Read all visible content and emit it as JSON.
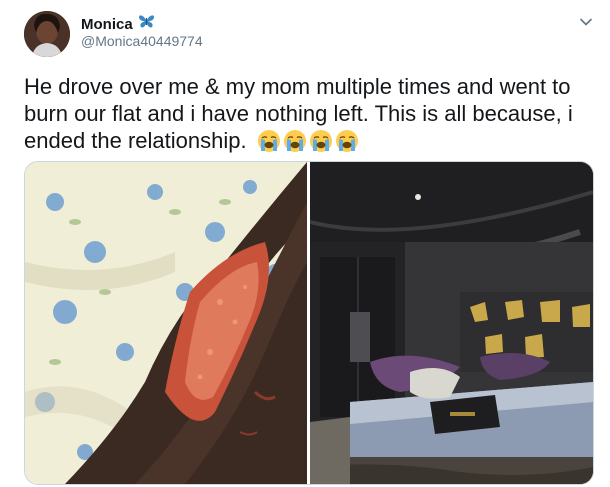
{
  "tweet": {
    "author": {
      "display_name": "Monica",
      "handle": "@Monica40449774",
      "name_badge_icon": "butterfly-icon"
    },
    "text": "He drove over me & my mom multiple times and went to burn our flat and i have nothing left. This is all because, i ended the relationship.",
    "emoji_icons": [
      "crying-face-icon",
      "crying-face-icon",
      "crying-face-icon",
      "crying-face-icon"
    ],
    "menu_icon": "chevron-down-icon",
    "media_count": 2
  },
  "colors": {
    "text_primary": "#14171a",
    "text_secondary": "#657786",
    "border": "#ccd6dd",
    "butterfly_blue": "#3b88c3",
    "emoji_yellow": "#ffcc4d"
  }
}
